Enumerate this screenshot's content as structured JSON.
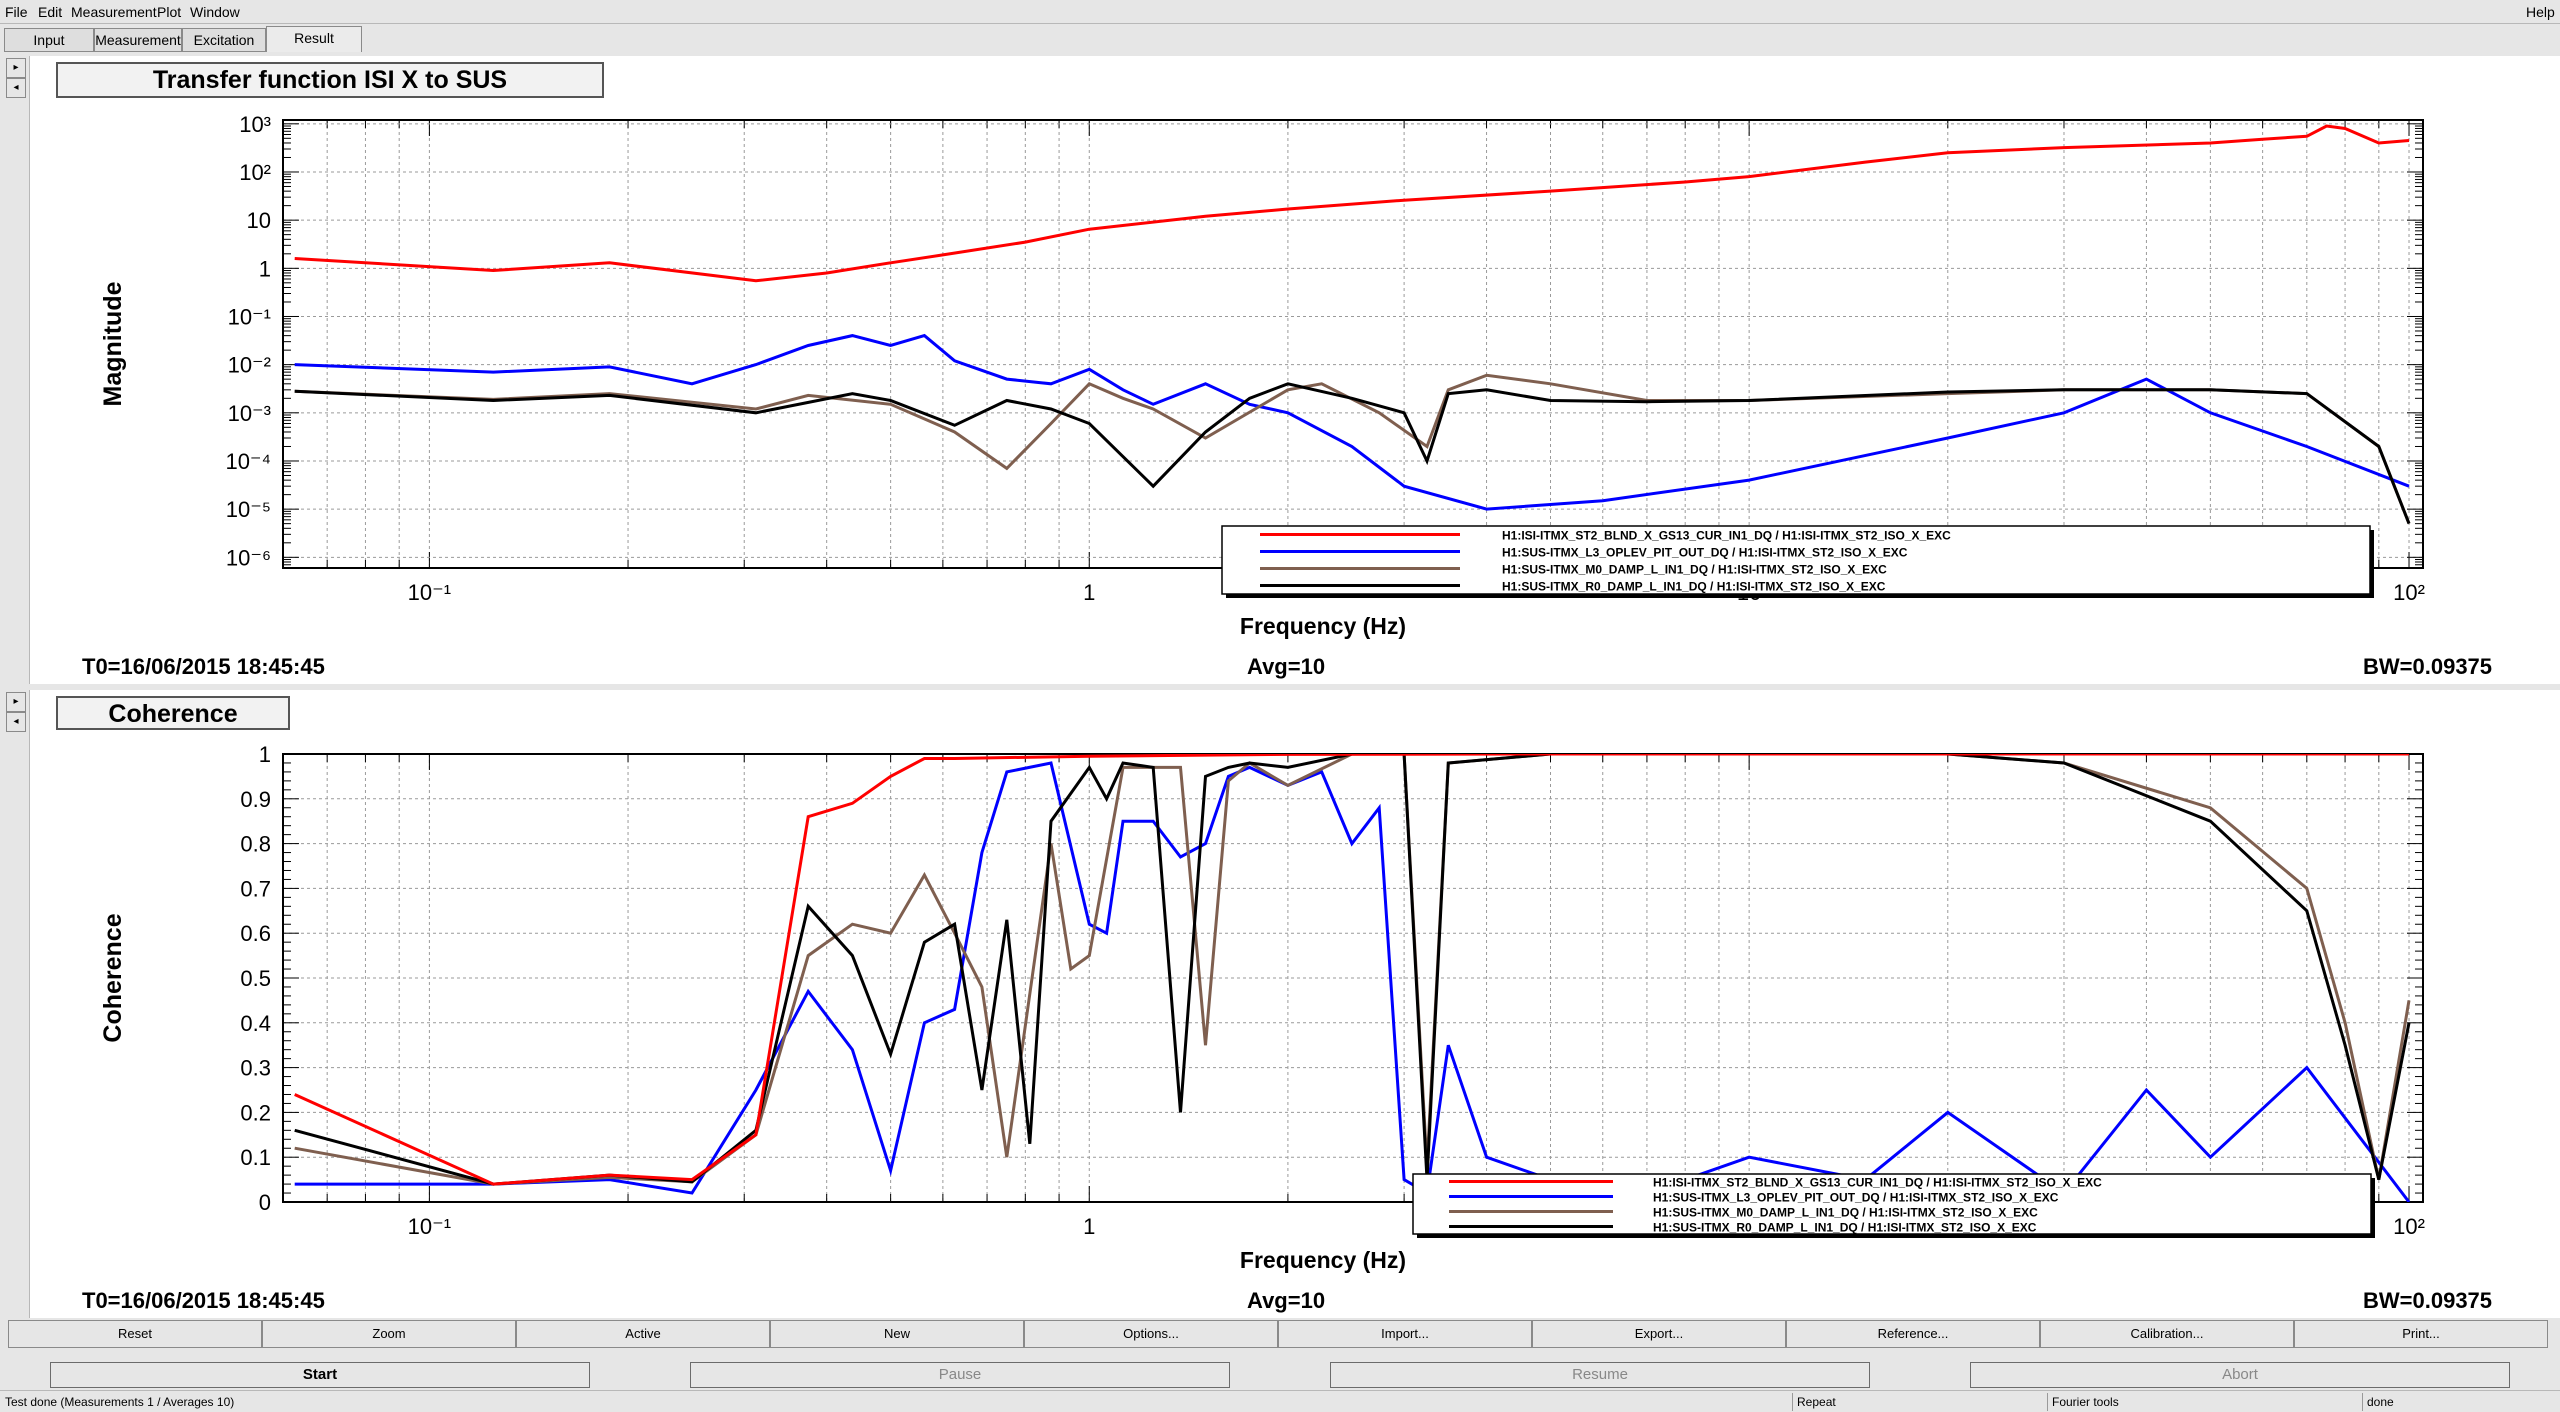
{
  "menu": {
    "file": "File",
    "edit": "Edit",
    "measurement": "Measurement",
    "plot": "Plot",
    "window": "Window",
    "help": "Help"
  },
  "tabs": [
    "Input",
    "Measurement",
    "Excitation",
    "Result"
  ],
  "panels": [
    {
      "title": "Transfer function ISI X to SUS",
      "t0": "T0=16/06/2015 18:45:45",
      "avg": "Avg=10",
      "bw": "BW=0.09375"
    },
    {
      "title": "Coherence",
      "t0": "T0=16/06/2015 18:45:45",
      "avg": "Avg=10",
      "bw": "BW=0.09375"
    }
  ],
  "side_buttons": [
    "▸",
    "◂"
  ],
  "chart_data": [
    {
      "type": "line",
      "xlabel": "Frequency (Hz)",
      "ylabel": "Magnitude",
      "xscale": "log",
      "yscale": "log",
      "xlim": [
        0.06,
        105
      ],
      "ylim": [
        6e-07,
        1200
      ],
      "xticks": [
        0.1,
        1,
        10,
        100
      ],
      "xtick_labels": [
        "10⁻¹",
        "1",
        "10",
        "10²"
      ],
      "yticks": [
        1e-06,
        1e-05,
        0.0001,
        0.001,
        0.01,
        0.1,
        1,
        10,
        100,
        1000
      ],
      "ytick_labels": [
        "10⁻⁶",
        "10⁻⁵",
        "10⁻⁴",
        "10⁻³",
        "10⁻²",
        "10⁻¹",
        "1",
        "10",
        "10²",
        "10³"
      ],
      "grid": true,
      "legend_position": "lower-right",
      "series": [
        {
          "name": "H1:ISI-ITMX_ST2_BLND_X_GS13_CUR_IN1_DQ / H1:ISI-ITMX_ST2_ISO_X_EXC",
          "color": "#ff0000",
          "x": [
            0.0625,
            0.125,
            0.1875,
            0.3125,
            0.4,
            0.5,
            0.6,
            0.8,
            1.0,
            1.5,
            2.0,
            3.0,
            5.0,
            8.0,
            10.0,
            15.0,
            20.0,
            30.0,
            50.0,
            60.0,
            70.0,
            75.0,
            80.0,
            90.0,
            100.0
          ],
          "y": [
            1.6,
            0.9,
            1.3,
            0.55,
            0.8,
            1.3,
            1.9,
            3.5,
            6.5,
            12,
            17,
            26,
            40,
            62,
            80,
            160,
            250,
            320,
            400,
            480,
            550,
            900,
            800,
            400,
            450
          ]
        },
        {
          "name": "H1:SUS-ITMX_L3_OPLEV_PIT_OUT_DQ / H1:ISI-ITMX_ST2_ISO_X_EXC",
          "color": "#0000ff",
          "x": [
            0.0625,
            0.125,
            0.1875,
            0.25,
            0.3125,
            0.375,
            0.4375,
            0.5,
            0.5625,
            0.625,
            0.75,
            0.875,
            1.0,
            1.125,
            1.25,
            1.5,
            1.75,
            2.0,
            2.5,
            3.0,
            4.0,
            6.0,
            10.0,
            20.0,
            30.0,
            40.0,
            50.0,
            70.0,
            100.0
          ],
          "y": [
            0.01,
            0.007,
            0.009,
            0.004,
            0.01,
            0.025,
            0.04,
            0.025,
            0.04,
            0.012,
            0.005,
            0.004,
            0.008,
            0.003,
            0.0015,
            0.004,
            0.0015,
            0.001,
            0.0002,
            3e-05,
            1e-05,
            1.5e-05,
            4e-05,
            0.0003,
            0.001,
            0.005,
            0.001,
            0.0002,
            3e-05
          ]
        },
        {
          "name": "H1:SUS-ITMX_M0_DAMP_L_IN1_DQ / H1:ISI-ITMX_ST2_ISO_X_EXC",
          "color": "#7f5f4f",
          "x": [
            0.0625,
            0.125,
            0.1875,
            0.3125,
            0.375,
            0.5,
            0.625,
            0.75,
            0.875,
            1.0,
            1.125,
            1.25,
            1.5,
            2.0,
            2.25,
            2.75,
            3.25,
            3.5,
            4.0,
            5.0,
            7.0,
            10.0,
            20.0,
            30.0,
            50.0,
            70.0,
            90.0,
            100.0
          ],
          "y": [
            0.0028,
            0.0019,
            0.0025,
            0.0012,
            0.0023,
            0.0015,
            0.0004,
            7e-05,
            0.0006,
            0.004,
            0.002,
            0.0012,
            0.0003,
            0.003,
            0.004,
            0.001,
            0.0002,
            0.003,
            0.006,
            0.004,
            0.0018,
            0.0018,
            0.0025,
            0.003,
            0.003,
            0.0025,
            0.0002,
            5e-06
          ]
        },
        {
          "name": "H1:SUS-ITMX_R0_DAMP_L_IN1_DQ / H1:ISI-ITMX_ST2_ISO_X_EXC",
          "color": "#000000",
          "x": [
            0.0625,
            0.125,
            0.1875,
            0.3125,
            0.4375,
            0.5,
            0.625,
            0.75,
            0.875,
            1.0,
            1.25,
            1.5,
            1.75,
            2.0,
            2.5,
            3.0,
            3.25,
            3.5,
            4.0,
            5.0,
            7.0,
            10.0,
            20.0,
            30.0,
            50.0,
            70.0,
            90.0,
            100.0
          ],
          "y": [
            0.0028,
            0.0018,
            0.0023,
            0.001,
            0.0025,
            0.0018,
            0.00055,
            0.0018,
            0.0012,
            0.0006,
            3e-05,
            0.0004,
            0.002,
            0.004,
            0.002,
            0.001,
            0.0001,
            0.0025,
            0.003,
            0.0018,
            0.0017,
            0.0018,
            0.0027,
            0.003,
            0.003,
            0.0025,
            0.0002,
            5e-06
          ]
        }
      ]
    },
    {
      "type": "line",
      "xlabel": "Frequency (Hz)",
      "ylabel": "Coherence",
      "xscale": "log",
      "yscale": "linear",
      "xlim": [
        0.06,
        105
      ],
      "ylim": [
        0,
        1
      ],
      "xticks": [
        0.1,
        1,
        10,
        100
      ],
      "xtick_labels": [
        "10⁻¹",
        "1",
        "10",
        "10²"
      ],
      "yticks": [
        0,
        0.1,
        0.2,
        0.3,
        0.4,
        0.5,
        0.6,
        0.7,
        0.8,
        0.9,
        1
      ],
      "ytick_labels": [
        "0",
        "0.1",
        "0.2",
        "0.3",
        "0.4",
        "0.5",
        "0.6",
        "0.7",
        "0.8",
        "0.9",
        "1"
      ],
      "grid": true,
      "legend_position": "lower-right",
      "series": [
        {
          "name": "H1:ISI-ITMX_ST2_BLND_X_GS13_CUR_IN1_DQ / H1:ISI-ITMX_ST2_ISO_X_EXC",
          "color": "#ff0000",
          "x": [
            0.0625,
            0.125,
            0.1875,
            0.25,
            0.3125,
            0.375,
            0.4375,
            0.5,
            0.5625,
            0.625,
            1.0,
            2.0,
            5.0,
            10.0,
            100.0
          ],
          "y": [
            0.24,
            0.04,
            0.06,
            0.05,
            0.15,
            0.86,
            0.89,
            0.95,
            0.99,
            0.99,
            0.995,
            0.999,
            1.0,
            1.0,
            1.0
          ]
        },
        {
          "name": "H1:SUS-ITMX_L3_OPLEV_PIT_OUT_DQ / H1:ISI-ITMX_ST2_ISO_X_EXC",
          "color": "#0000ff",
          "x": [
            0.0625,
            0.125,
            0.1875,
            0.25,
            0.3125,
            0.375,
            0.4375,
            0.5,
            0.5625,
            0.625,
            0.6875,
            0.75,
            0.875,
            1.0,
            1.0625,
            1.125,
            1.25,
            1.375,
            1.5,
            1.625,
            1.75,
            2.0,
            2.25,
            2.5,
            2.75,
            3.0,
            3.25,
            3.5,
            4.0,
            5.0,
            7.0,
            10.0,
            15.0,
            20.0,
            30.0,
            40.0,
            50.0,
            70.0,
            100.0
          ],
          "y": [
            0.04,
            0.04,
            0.05,
            0.02,
            0.25,
            0.47,
            0.34,
            0.07,
            0.4,
            0.43,
            0.78,
            0.96,
            0.98,
            0.62,
            0.6,
            0.85,
            0.85,
            0.77,
            0.8,
            0.95,
            0.97,
            0.93,
            0.96,
            0.8,
            0.88,
            0.05,
            0.02,
            0.35,
            0.1,
            0.05,
            0.02,
            0.1,
            0.05,
            0.2,
            0.02,
            0.25,
            0.1,
            0.3,
            0.0
          ]
        },
        {
          "name": "H1:SUS-ITMX_M0_DAMP_L_IN1_DQ / H1:ISI-ITMX_ST2_ISO_X_EXC",
          "color": "#7f5f4f",
          "x": [
            0.0625,
            0.125,
            0.1875,
            0.25,
            0.3125,
            0.375,
            0.4375,
            0.5,
            0.5625,
            0.625,
            0.6875,
            0.75,
            0.875,
            0.9375,
            1.0,
            1.125,
            1.25,
            1.375,
            1.5,
            1.625,
            1.75,
            2.0,
            2.5,
            3.0,
            3.25,
            3.5,
            5.0,
            10.0,
            20.0,
            30.0,
            50.0,
            70.0,
            80.0,
            90.0,
            100.0
          ],
          "y": [
            0.12,
            0.04,
            0.055,
            0.045,
            0.15,
            0.55,
            0.62,
            0.6,
            0.73,
            0.6,
            0.48,
            0.1,
            0.8,
            0.52,
            0.55,
            0.97,
            0.97,
            0.97,
            0.35,
            0.94,
            0.98,
            0.93,
            1.0,
            1.0,
            0.08,
            0.98,
            1.0,
            1.0,
            1.0,
            0.98,
            0.88,
            0.7,
            0.4,
            0.05,
            0.45
          ]
        },
        {
          "name": "H1:SUS-ITMX_R0_DAMP_L_IN1_DQ / H1:ISI-ITMX_ST2_ISO_X_EXC",
          "color": "#000000",
          "x": [
            0.0625,
            0.125,
            0.1875,
            0.25,
            0.3125,
            0.375,
            0.4375,
            0.5,
            0.5625,
            0.625,
            0.6875,
            0.75,
            0.8125,
            0.875,
            1.0,
            1.0625,
            1.125,
            1.25,
            1.375,
            1.5,
            1.625,
            1.75,
            2.0,
            2.5,
            3.0,
            3.25,
            3.5,
            5.0,
            10.0,
            20.0,
            30.0,
            50.0,
            70.0,
            80.0,
            90.0,
            100.0
          ],
          "y": [
            0.16,
            0.04,
            0.06,
            0.045,
            0.16,
            0.66,
            0.55,
            0.33,
            0.58,
            0.62,
            0.25,
            0.63,
            0.13,
            0.85,
            0.97,
            0.9,
            0.98,
            0.97,
            0.2,
            0.95,
            0.97,
            0.98,
            0.97,
            1.0,
            1.0,
            0.05,
            0.98,
            1.0,
            1.0,
            1.0,
            0.98,
            0.85,
            0.65,
            0.35,
            0.05,
            0.4
          ]
        }
      ]
    }
  ],
  "toolbar": [
    "Reset",
    "Zoom",
    "Active",
    "New",
    "Options...",
    "Import...",
    "Export...",
    "Reference...",
    "Calibration...",
    "Print..."
  ],
  "controls": {
    "start": "Start",
    "pause": "Pause",
    "resume": "Resume",
    "abort": "Abort"
  },
  "status": {
    "message": "Test done (Measurements 1 / Averages 10)",
    "repeat": "Repeat",
    "fourier": "Fourier tools",
    "state": "done"
  }
}
